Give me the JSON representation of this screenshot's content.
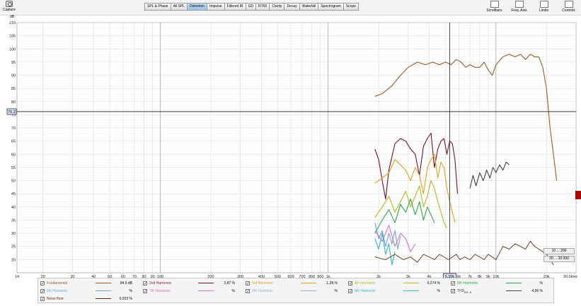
{
  "toolbar": {
    "capture_label": "Capture",
    "tabs": [
      {
        "label": "SPL & Phase",
        "active": false
      },
      {
        "label": "All SPL",
        "active": false
      },
      {
        "label": "Distortion",
        "active": true
      },
      {
        "label": "Impulse",
        "active": false
      },
      {
        "label": "Filtered IR",
        "active": false
      },
      {
        "label": "GD",
        "active": false
      },
      {
        "label": "RT60",
        "active": false
      },
      {
        "label": "Clarity",
        "active": false
      },
      {
        "label": "Decay",
        "active": false
      },
      {
        "label": "Waterfall",
        "active": false
      },
      {
        "label": "Spectrogram",
        "active": false
      },
      {
        "label": "Scope",
        "active": false
      }
    ],
    "right_tools": [
      "Scrollbars",
      "Freq. Axis",
      "Limits",
      "Controls"
    ]
  },
  "plot": {
    "y_unit": "dB",
    "y_cursor_readout": "76.2",
    "x_cursor_readout": "5,30k",
    "y_ticks": [
      "110",
      "105",
      "100",
      "95",
      "90",
      "85",
      "80",
      "75",
      "70",
      "65",
      "60",
      "55",
      "50",
      "45",
      "40",
      "35",
      "30",
      "25",
      "20"
    ],
    "x_ticks": [
      "14",
      "20",
      "30",
      "40",
      "50",
      "60",
      "70",
      "80",
      "90",
      "100",
      "200",
      "300",
      "400",
      "500",
      "600",
      "700",
      "800",
      "900",
      "1k",
      "2k",
      "3k",
      "4k",
      "5k",
      "6k",
      "7k",
      "8k",
      "9k",
      "10k",
      "20k",
      "30,0kHz"
    ],
    "range_box_top": "10 ... 200",
    "range_box_bottom": "20 ... 20 000"
  },
  "chart_data": {
    "type": "line",
    "xlabel": "",
    "ylabel": "dB",
    "x_scale": "log",
    "xlim": [
      14,
      30000
    ],
    "ylim": [
      15,
      110
    ],
    "grid": true,
    "series": [
      {
        "name": "Fundamental",
        "color": "#9a5a2a",
        "x": [
          1900,
          2100,
          2400,
          2700,
          3000,
          3400,
          3800,
          4200,
          4600,
          5000,
          5400,
          5800,
          6200,
          6600,
          7000,
          7500,
          8000,
          8500,
          9000,
          9500,
          10000,
          11000,
          12000,
          13000,
          14000,
          15000,
          16000,
          17000,
          18000,
          19000,
          20000,
          21000,
          22000,
          23000
        ],
        "y": [
          82,
          83,
          86,
          90,
          93,
          95,
          94,
          95,
          94,
          95,
          94,
          96,
          95,
          93,
          94,
          93,
          93,
          95,
          92,
          90,
          94,
          97,
          98,
          97,
          98,
          96,
          98,
          97,
          97,
          93,
          85,
          70,
          60,
          50
        ]
      },
      {
        "name": "2nd Harmonic",
        "color": "#7a1020",
        "x": [
          1900,
          2000,
          2100,
          2200,
          2300,
          2500,
          2700,
          2900,
          3100,
          3300,
          3500,
          3700,
          3900,
          4100,
          4300,
          4500,
          4700,
          4900,
          5100,
          5300,
          5500,
          5700,
          5900
        ],
        "y": [
          62,
          58,
          50,
          43,
          54,
          64,
          66,
          65,
          62,
          60,
          52,
          63,
          66,
          68,
          55,
          62,
          65,
          66,
          60,
          65,
          64,
          58,
          45
        ]
      },
      {
        "name": "3rd Harmonic",
        "color": "#e0a020",
        "x": [
          1900,
          2100,
          2300,
          2500,
          2700,
          2900,
          3100,
          3300,
          3500,
          3700,
          3900,
          4100,
          4300,
          4500,
          4700,
          4900,
          5100,
          5300,
          5500,
          5700
        ],
        "y": [
          49,
          51,
          53,
          58,
          56,
          54,
          50,
          55,
          52,
          45,
          55,
          58,
          60,
          51,
          57,
          55,
          47,
          42,
          38,
          34
        ]
      },
      {
        "name": "4th Harmonic",
        "color": "#b8b820",
        "x": [
          1900,
          2100,
          2300,
          2500,
          2700,
          2900,
          3100,
          3300,
          3500,
          3700,
          3900,
          4100,
          4300,
          4500,
          4700,
          4900,
          5100
        ],
        "y": [
          36,
          40,
          44,
          38,
          42,
          46,
          40,
          44,
          48,
          40,
          44,
          50,
          47,
          42,
          38,
          34,
          32
        ]
      },
      {
        "name": "5th Harmonic",
        "color": "#2ba84a",
        "x": [
          1900,
          2100,
          2300,
          2500,
          2700,
          2900,
          3100,
          3300,
          3500,
          3700,
          3900,
          4100,
          4300
        ],
        "y": [
          30,
          35,
          39,
          34,
          41,
          38,
          43,
          37,
          42,
          35,
          40,
          37,
          34
        ]
      },
      {
        "name": "THD",
        "color": "#404050",
        "x": [
          7000,
          7300,
          7600,
          8000,
          8400,
          8800,
          9200,
          9600,
          10000,
          10500,
          11000,
          11500,
          12000
        ],
        "y": [
          47,
          52,
          48,
          53,
          50,
          54,
          51,
          55,
          53,
          56,
          54,
          57,
          56
        ]
      },
      {
        "name": "6th Harmonic",
        "color": "#6aa8e0",
        "x": [
          1900,
          2000,
          2100,
          2200,
          2300,
          2400,
          2500,
          2600,
          2700
        ],
        "y": [
          34,
          28,
          31,
          25,
          30,
          26,
          31,
          24,
          29
        ]
      },
      {
        "name": "7th Harmonic",
        "color": "#e070c0",
        "x": [
          1900,
          2100,
          2300,
          2500,
          2700,
          2900,
          3100,
          3300
        ],
        "y": [
          31,
          27,
          33,
          25,
          30,
          28,
          23,
          26
        ]
      },
      {
        "name": "9th Harmonic",
        "color": "#30b8d0",
        "x": [
          1900,
          2000,
          2100,
          2200,
          2300,
          2400,
          2500
        ],
        "y": [
          28,
          24,
          30,
          22,
          26,
          18,
          23
        ]
      },
      {
        "name": "Noise floor",
        "color": "#5a3010",
        "x": [
          1900,
          2200,
          2500,
          2800,
          3100,
          3400,
          3700,
          4000,
          4300,
          4600,
          4900,
          5200,
          5500,
          5800,
          6100,
          6500,
          7000,
          7500,
          8000,
          8500,
          9000,
          9500,
          10000,
          11000,
          12000,
          13000,
          14000,
          15000,
          16000,
          17000,
          18000,
          19000,
          20000,
          21000,
          22000
        ],
        "y": [
          21,
          20,
          22,
          20,
          21,
          19,
          22,
          21,
          20,
          22,
          21,
          20,
          21,
          22,
          20,
          21,
          20,
          22,
          21,
          20,
          22,
          21,
          20,
          25,
          24,
          26,
          25,
          24,
          27,
          25,
          24,
          23,
          22,
          20,
          18
        ]
      }
    ]
  },
  "legend": {
    "rows": [
      {
        "label": "Fundamental",
        "value": "94,6 dB",
        "color": "#9a5a2a"
      },
      {
        "label": "2nd Harmonic",
        "value": "3,87 %",
        "color": "#7a1020"
      },
      {
        "label": "3rd Harmonic",
        "value": "1,28 %",
        "color": "#e0a020"
      },
      {
        "label": "4th Harmonic",
        "value": "0,274 %",
        "color": "#b8b820"
      },
      {
        "label": "5th Harmonic",
        "value": "%",
        "color": "#2ba84a"
      },
      {
        "label": "6th Harmonic",
        "value": "%",
        "color": "#6aa8e0"
      },
      {
        "label": "7th Harmonic",
        "value": "%",
        "color": "#e070c0"
      },
      {
        "label": "8th Harmonic",
        "value": "%",
        "color": "#9ab0d0"
      },
      {
        "label": "9th Harmonic",
        "value": "%",
        "color": "#30b8d0"
      },
      {
        "label": "THD",
        "label_sub": "H2..9",
        "value": "4,06 %",
        "color": "#404050"
      },
      {
        "label": "Noise floor",
        "value": "0,023 %",
        "color": "#5a3010"
      }
    ]
  }
}
